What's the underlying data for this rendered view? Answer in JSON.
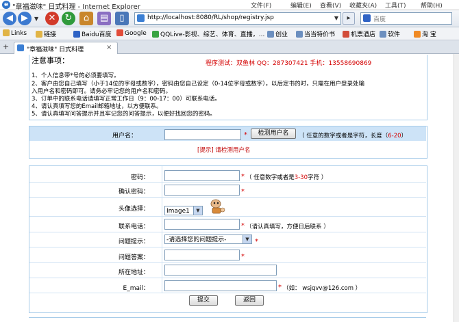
{
  "window": {
    "title": "\"章福滋味\" 日式料理 - Internet Explorer",
    "menu": [
      "文件(F)",
      "编辑(E)",
      "查看(V)",
      "收藏夹(A)",
      "工具(T)",
      "帮助(H)"
    ]
  },
  "nav": {
    "address": "http://localhost:8080/RL/shop/registry.jsp",
    "search_placeholder": "百度"
  },
  "links": [
    "Links",
    "链接",
    "Baidu百度",
    "Google",
    "QQLive-影视、综艺、体育、直播，...",
    "创业",
    "当当特价书",
    "机票酒店",
    "软件",
    "淘 宝"
  ],
  "tab": {
    "label": "\"章福滋味\" 日式料理",
    "close": "×",
    "new": "+"
  },
  "notice": {
    "title": "注意事项：",
    "test_info": "程序测试：双鱼林  QQ：287307421  手机：13558690869",
    "lines": [
      "1、个人信息带*号的必须要填写。",
      "2、客户由您自己填写（小于14位的字母或数字），密码由您自己设定（0-14位字母或数字），以后定书的时，只需在用户登录处输",
      "入用户名和密码即可。请务必牢记您的用户名和密码。",
      "3、订单中的联系电话请填写正常工作日（9：00-17：00）可联系电话。",
      "4、请认真填写您的Email邮箱地址，以方便联系。",
      "5、请认真填写问答提示并且牢记您的问答提示，以便好找回您的密码。"
    ]
  },
  "user": {
    "label": "用户名：",
    "check_button": "检测用户名",
    "hint_prefix": "（ 任意的数字或者是字符，长度（",
    "hint_range": "6-20",
    "hint_suffix": "）",
    "tip_label": "[提示]",
    "tip_text": "请检测用户名"
  },
  "form": {
    "password": {
      "label": "密码：",
      "hint_prefix": "（ 任意数字或者是",
      "hint_range": "3-30",
      "hint_suffix": "字符 ）"
    },
    "confirm": {
      "label": "确认密码："
    },
    "avatar": {
      "label": "头像选择：",
      "selected": "Image1"
    },
    "phone": {
      "label": "联系电话：",
      "hint": "（请认真填写，方便日后联系 ）"
    },
    "question": {
      "label": "问题提示：",
      "selected": "-请选择您的问题提示-"
    },
    "answer": {
      "label": "问题答案："
    },
    "address": {
      "label": "所在地址："
    },
    "email": {
      "label": "E_mail：",
      "hint": "（如： wsjqvv@126.com ）"
    },
    "submit": "提交",
    "back": "返回",
    "star": "*"
  }
}
